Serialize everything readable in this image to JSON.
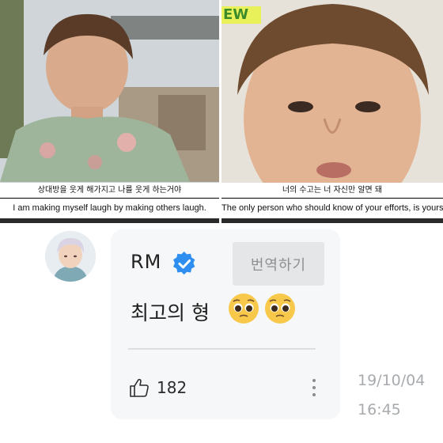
{
  "frames": {
    "left": {
      "subtitle_ko": "상대방을 웃게 해가지고 나를 웃게 하는거야",
      "subtitle_en": "I am making myself laugh by making others laugh."
    },
    "right": {
      "badge": "EW",
      "subtitle_ko": "너의 수고는 너 자신만 알면 돼",
      "subtitle_en": "The only person who should know of your efforts, is yours"
    }
  },
  "comment": {
    "author": "RM",
    "verified_icon": "verified-check-icon",
    "translate_label": "번역하기",
    "text": "최고의 형",
    "emoji": [
      "pleading-face-emoji",
      "pleading-face-emoji"
    ],
    "likes": "182",
    "date": "19/10/04",
    "time": "16:45"
  },
  "colors": {
    "verified_blue": "#2f8ff0",
    "card_bg": "#f6f7f8",
    "button_bg": "#e4e6e8",
    "meta_text": "#a8abae"
  }
}
